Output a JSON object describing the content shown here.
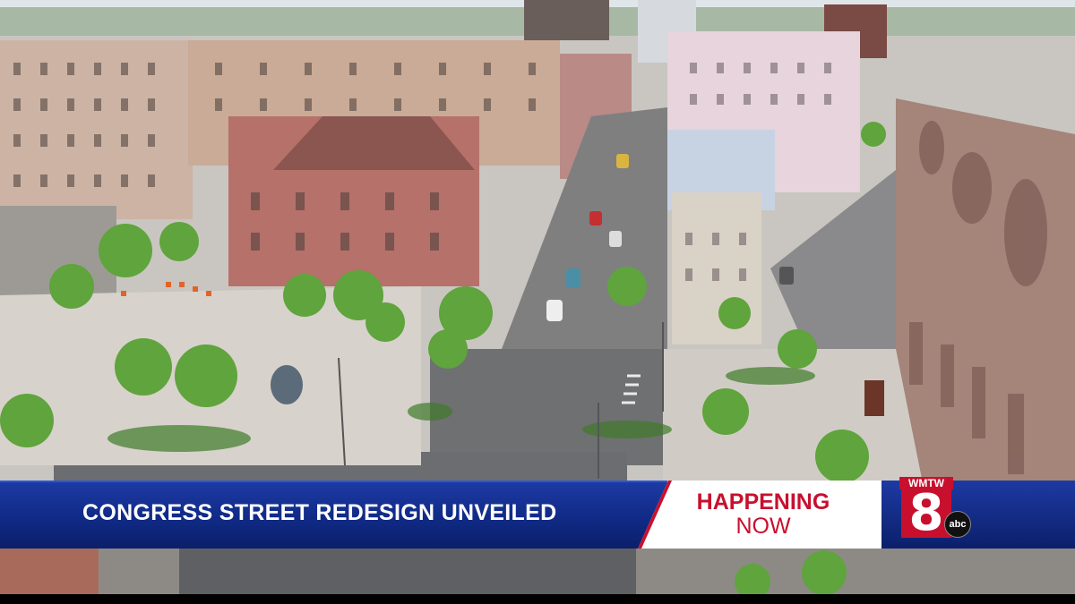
{
  "broadcast": {
    "headline": "CONGRESS STREET REDESIGN UNVEILED",
    "status_line1": "HAPPENING",
    "status_line2": "NOW",
    "station_call": "WMTW",
    "station_channel": "8",
    "network": "abc"
  },
  "colors": {
    "headline_bar": "#102a86",
    "accent_red": "#c8102e",
    "status_bg": "#ffffff",
    "sky": "#dfe6ea",
    "brick": "#b5716a",
    "grass": "#5fa43c"
  }
}
